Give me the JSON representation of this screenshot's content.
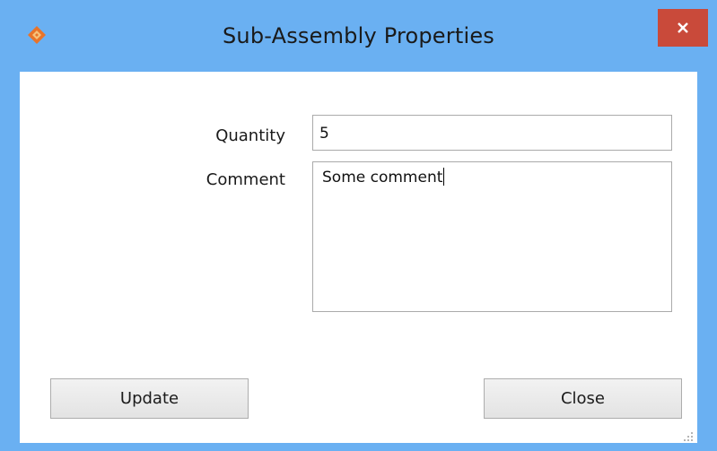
{
  "window": {
    "title": "Sub-Assembly Properties",
    "icon": "app-diamond-icon",
    "close_icon": "close-icon",
    "accent_color": "#6ab0f2",
    "close_color": "#c94a3a"
  },
  "form": {
    "quantity_label": "Quantity",
    "quantity_value": "5",
    "comment_label": "Comment",
    "comment_value": "Some comment"
  },
  "buttons": {
    "update_label": "Update",
    "close_label": "Close"
  }
}
